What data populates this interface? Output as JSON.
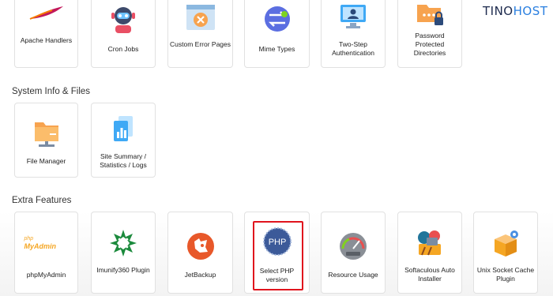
{
  "brand": {
    "part1": "TINO",
    "part2": "HOST"
  },
  "colors": {
    "highlight": "#e0141d",
    "accent": "#2a7fe0"
  },
  "advanced": {
    "items": [
      {
        "label": "Apache Handlers",
        "icon": "feather-icon"
      },
      {
        "label": "Cron Jobs",
        "icon": "robot-icon"
      },
      {
        "label": "Custom Error Pages",
        "icon": "error-page-icon"
      },
      {
        "label": "Mime Types",
        "icon": "arrows-icon"
      },
      {
        "label": "Two-Step Authentication",
        "icon": "monitor-user-icon"
      },
      {
        "label": "Password Protected Directories",
        "icon": "folder-lock-icon"
      }
    ]
  },
  "system": {
    "title": "System Info & Files",
    "items": [
      {
        "label": "File Manager",
        "icon": "folder-icon"
      },
      {
        "label": "Site Summary / Statistics / Logs",
        "icon": "stats-icon"
      }
    ]
  },
  "extra": {
    "title": "Extra Features",
    "items": [
      {
        "label": "phpMyAdmin",
        "icon": "phpmyadmin-icon",
        "logo_small": "php",
        "logo_big": "MyAdmin"
      },
      {
        "label": "Imunify360 Plugin",
        "icon": "imunify-icon"
      },
      {
        "label": "JetBackup",
        "icon": "jetbackup-icon"
      },
      {
        "label": "Select PHP version",
        "icon": "php-icon",
        "logo": "PHP",
        "highlighted": true
      },
      {
        "label": "Resource Usage",
        "icon": "gauge-icon"
      },
      {
        "label": "Softaculous Auto Installer",
        "icon": "softaculous-icon"
      },
      {
        "label": "Unix Socket Cache Plugin",
        "icon": "box-gear-icon"
      }
    ]
  }
}
